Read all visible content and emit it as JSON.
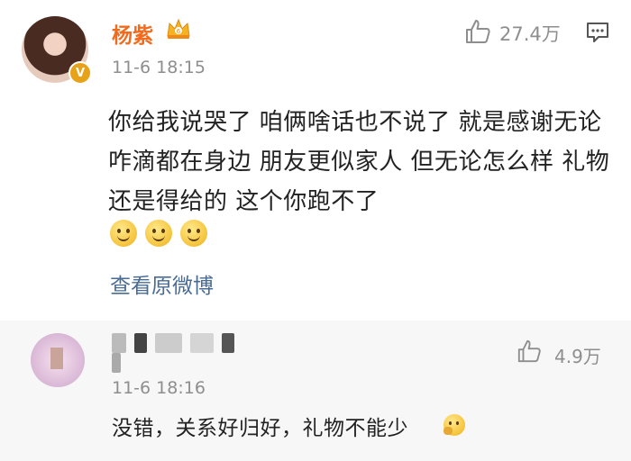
{
  "post": {
    "username": "杨紫",
    "timestamp": "11-6 18:15",
    "likes": "27.4万",
    "content": "你给我说哭了 咱俩啥话也不说了 就是感谢无论咋滴都在身边 朋友更似家人  但无论怎么样 礼物还是得给的 这个你跑不了",
    "emoji_count": 3,
    "view_original": "查看原微博",
    "badge_icon": "verified-v-icon",
    "crown_icon": "vip-crown-icon",
    "colors": {
      "username": "#f26a1b",
      "link": "#4a6c94",
      "meta": "#8e8e8e"
    }
  },
  "reply": {
    "username_blurred": true,
    "timestamp": "11-6 18:16",
    "likes": "4.9万",
    "content": "没错，关系好归好，礼物不能少"
  }
}
